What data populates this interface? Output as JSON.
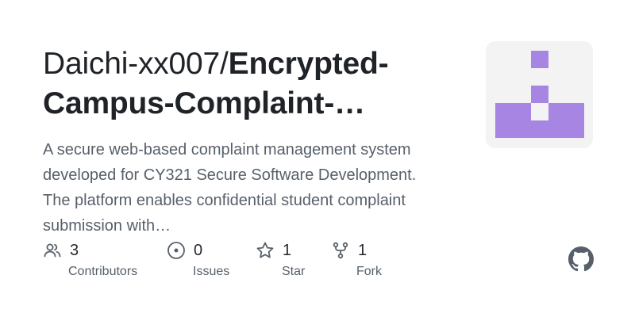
{
  "repo": {
    "owner": "Daichi-xx007/",
    "name": "Encrypted-Campus-Complaint-…",
    "description": "A secure web-based complaint management system developed for CY321 Secure Software Development. The platform enables confidential student complaint submission with…"
  },
  "stats": {
    "contributors": {
      "count": "3",
      "label": "Contributors",
      "icon": "people-icon"
    },
    "issues": {
      "count": "0",
      "label": "Issues",
      "icon": "issue-opened-icon"
    },
    "stars": {
      "count": "1",
      "label": "Star",
      "icon": "star-icon"
    },
    "forks": {
      "count": "1",
      "label": "Fork",
      "icon": "repo-forked-icon"
    }
  },
  "colors": {
    "identicon": "#a785e2",
    "identicon_bg": "#f3f3f3",
    "text_primary": "#1f2328",
    "text_secondary": "#57606a",
    "icon": "#57606a"
  }
}
